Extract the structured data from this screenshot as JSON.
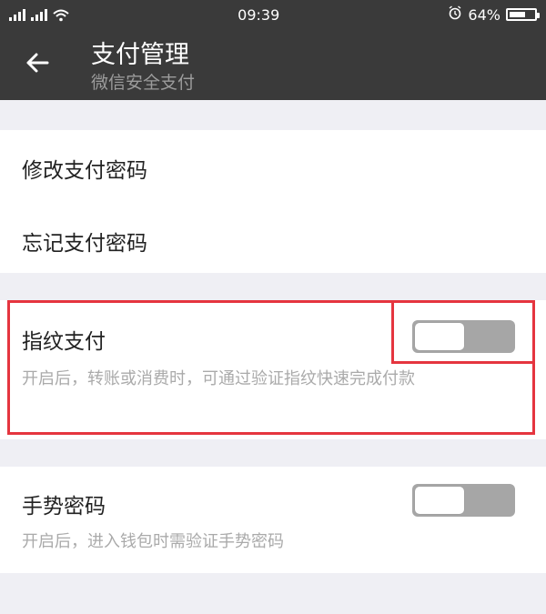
{
  "status_bar": {
    "time": "09:39",
    "battery": "64%",
    "battery_level": 0.64,
    "icons": [
      "signal-icon",
      "wifi-icon",
      "alarm-icon",
      "battery-icon"
    ]
  },
  "header": {
    "back_icon": "arrow-left-icon",
    "title": "支付管理",
    "subtitle": "微信安全支付"
  },
  "settings": {
    "change_password": "修改支付密码",
    "forgot_password": "忘记支付密码",
    "fingerprint": {
      "label": "指纹支付",
      "desc": "开启后，转账或消费时，可通过验证指纹快速完成付款",
      "enabled": false
    },
    "gesture": {
      "label": "手势密码",
      "desc": "开启后，进入钱包时需验证手势密码",
      "enabled": false
    }
  },
  "colors": {
    "topbar": "#3a3a3a",
    "highlight": "#e5353f",
    "toggle_off": "#a6a6a6"
  }
}
